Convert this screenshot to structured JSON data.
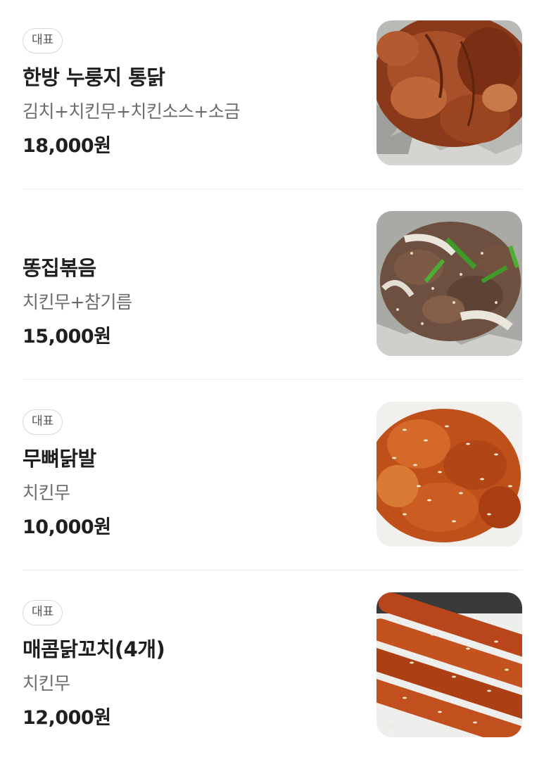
{
  "menu": {
    "items": [
      {
        "badge": "대표",
        "name": "한방 누룽지 통닭",
        "description": "김치+치킨무+치킨소스+소금",
        "price": "18,000원",
        "photo_icon": "roast-chicken-photo"
      },
      {
        "badge": "",
        "name": "똥집볶음",
        "description": "치킨무+참기름",
        "price": "15,000원",
        "photo_icon": "stir-fried-gizzard-photo"
      },
      {
        "badge": "대표",
        "name": "무뼈닭발",
        "description": "치킨무",
        "price": "10,000원",
        "photo_icon": "boneless-chicken-feet-photo"
      },
      {
        "badge": "대표",
        "name": "매콤닭꼬치(4개)",
        "description": "치킨무",
        "price": "12,000원",
        "photo_icon": "spicy-chicken-skewers-photo"
      }
    ]
  },
  "colors": {
    "badge_border": "#d9d9d9",
    "divider": "#ececec",
    "name_text": "#1f1f1f",
    "desc_text": "#6b6b6b"
  }
}
